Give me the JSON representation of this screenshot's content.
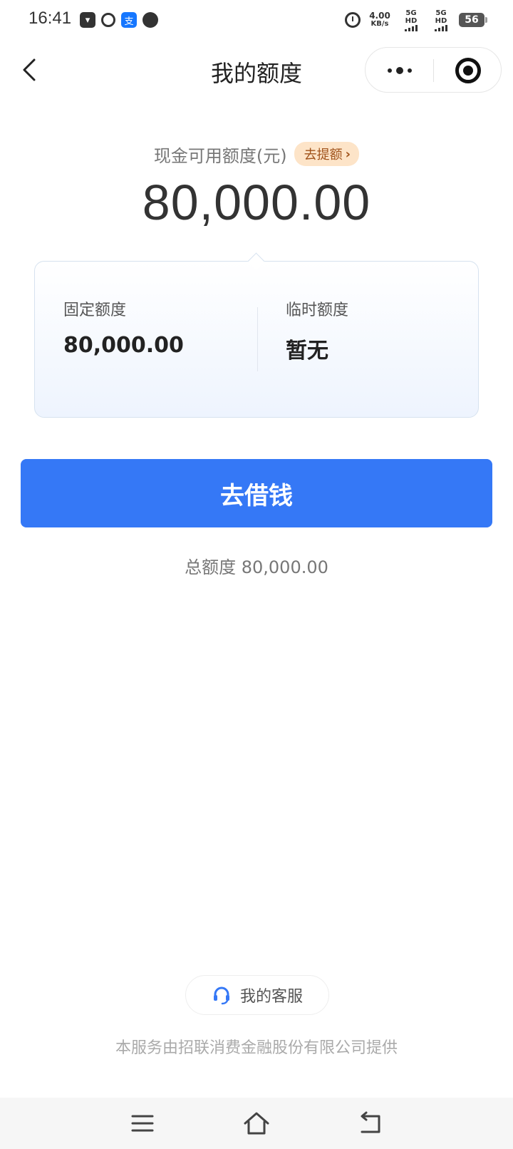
{
  "status_bar": {
    "time": "16:41",
    "speed_value": "4.00",
    "speed_unit": "KB/s",
    "net1": "5G HD",
    "net2": "5G HD",
    "battery": "56",
    "app_icons": [
      "shopping-bag-icon",
      "bilibili-ring-icon",
      "alipay-icon",
      "chat-bubble-icon"
    ]
  },
  "nav": {
    "title": "我的额度"
  },
  "main": {
    "available_label": "现金可用额度(元)",
    "withdraw_label": "去提额",
    "available_amount": "80,000.00",
    "fixed_label": "固定额度",
    "fixed_value": "80,000.00",
    "temp_label": "临时额度",
    "temp_value": "暂无",
    "borrow_label": "去借钱",
    "total_label": "总额度 80,000.00"
  },
  "footer": {
    "service_label": "我的客服",
    "note": "本服务由招联消费金融股份有限公司提供"
  },
  "colors": {
    "primary": "#3578f6",
    "tag_bg": "#fde4c8",
    "tag_text": "#a0521a"
  }
}
